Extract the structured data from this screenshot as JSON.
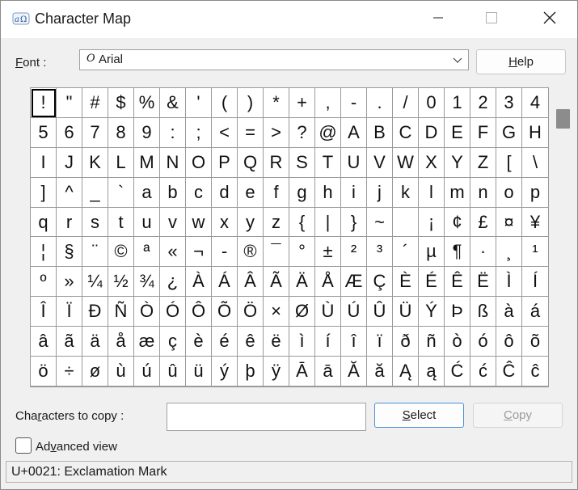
{
  "window": {
    "title": "Character Map",
    "icon": "character-map-app-icon",
    "controls": {
      "minimize": "minimize-icon",
      "maximize": "maximize-icon",
      "close": "close-icon"
    }
  },
  "font": {
    "label_prefix": "F",
    "label_rest": "ont :",
    "selected_glyph": "O",
    "selected_name": "Arial"
  },
  "help_button": {
    "prefix": "",
    "underlined": "H",
    "rest": "elp"
  },
  "characters": [
    "!",
    "\"",
    "#",
    "$",
    "%",
    "&",
    "'",
    "(",
    ")",
    "*",
    "+",
    ",",
    "-",
    ".",
    "/",
    "0",
    "1",
    "2",
    "3",
    "4",
    "5",
    "6",
    "7",
    "8",
    "9",
    ":",
    ";",
    "<",
    "=",
    ">",
    "?",
    "@",
    "A",
    "B",
    "C",
    "D",
    "E",
    "F",
    "G",
    "H",
    "I",
    "J",
    "K",
    "L",
    "M",
    "N",
    "O",
    "P",
    "Q",
    "R",
    "S",
    "T",
    "U",
    "V",
    "W",
    "X",
    "Y",
    "Z",
    "[",
    "\\",
    "]",
    "^",
    "_",
    "`",
    "a",
    "b",
    "c",
    "d",
    "e",
    "f",
    "g",
    "h",
    "i",
    "j",
    "k",
    "l",
    "m",
    "n",
    "o",
    "p",
    "q",
    "r",
    "s",
    "t",
    "u",
    "v",
    "w",
    "x",
    "y",
    "z",
    "{",
    "|",
    "}",
    "~",
    " ",
    "¡",
    "¢",
    "£",
    "¤",
    "¥",
    "¦",
    "§",
    "¨",
    "©",
    "ª",
    "«",
    "¬",
    "-",
    "®",
    "¯",
    "°",
    "±",
    "²",
    "³",
    "´",
    "µ",
    "¶",
    "·",
    "¸",
    "¹",
    "º",
    "»",
    "¼",
    "½",
    "¾",
    "¿",
    "À",
    "Á",
    "Â",
    "Ã",
    "Ä",
    "Å",
    "Æ",
    "Ç",
    "È",
    "É",
    "Ê",
    "Ë",
    "Ì",
    "Í",
    "Î",
    "Ï",
    "Ð",
    "Ñ",
    "Ò",
    "Ó",
    "Ô",
    "Õ",
    "Ö",
    "×",
    "Ø",
    "Ù",
    "Ú",
    "Û",
    "Ü",
    "Ý",
    "Þ",
    "ß",
    "à",
    "á",
    "â",
    "ã",
    "ä",
    "å",
    "æ",
    "ç",
    "è",
    "é",
    "ê",
    "ë",
    "ì",
    "í",
    "î",
    "ï",
    "ð",
    "ñ",
    "ò",
    "ó",
    "ô",
    "õ",
    "ö",
    "÷",
    "ø",
    "ù",
    "ú",
    "û",
    "ü",
    "ý",
    "þ",
    "ÿ",
    "Ā",
    "ā",
    "Ă",
    "ă",
    "Ą",
    "ą",
    "Ć",
    "ć",
    "Ĉ",
    "ĉ"
  ],
  "selected_index": 0,
  "copy": {
    "label_prefix": "Cha",
    "label_underlined": "r",
    "label_rest": "acters to copy :",
    "value": ""
  },
  "select_button": {
    "underlined": "S",
    "rest": "elect"
  },
  "copy_button": {
    "underlined": "C",
    "rest": "opy"
  },
  "advanced": {
    "prefix": "Ad",
    "underlined": "v",
    "rest": "anced view",
    "checked": false
  },
  "status": "U+0021: Exclamation Mark",
  "colors": {
    "accent": "#4a90d9",
    "dialog_bg": "#f0f0f0",
    "grid_line": "#9a9a9a"
  }
}
